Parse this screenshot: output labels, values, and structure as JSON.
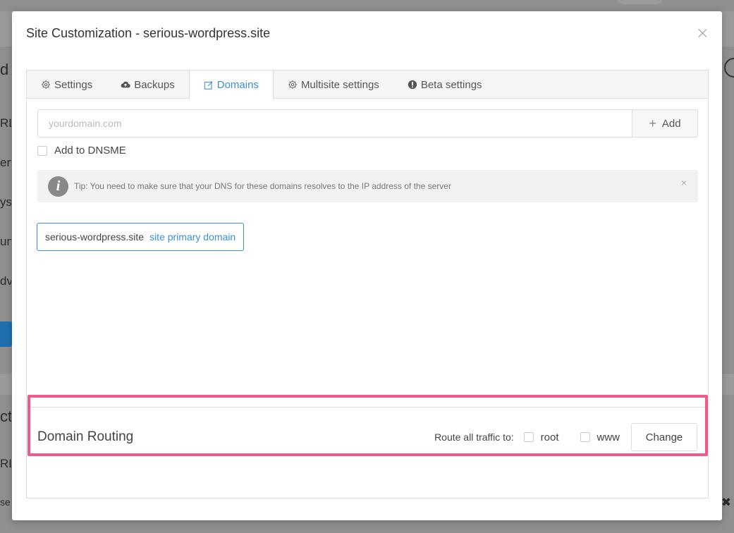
{
  "background": {
    "fragments": [
      "d",
      "RL",
      "erv",
      "yst",
      "un",
      "dv",
      "ct",
      "RL",
      "se"
    ],
    "right_close": "✖"
  },
  "modal": {
    "title": "Site Customization - serious-wordpress.site",
    "close_label": "×"
  },
  "tabs": [
    {
      "label": "Settings",
      "icon": "gear-icon",
      "active": false
    },
    {
      "label": "Backups",
      "icon": "cloud-upload-icon",
      "active": false
    },
    {
      "label": "Domains",
      "icon": "edit-icon",
      "active": true
    },
    {
      "label": "Multisite settings",
      "icon": "gear-icon",
      "active": false
    },
    {
      "label": "Beta settings",
      "icon": "exclamation-circle-icon",
      "active": false
    }
  ],
  "domains": {
    "input_placeholder": "yourdomain.com",
    "input_value": "",
    "add_button": "Add",
    "dnsme_label": "Add to DNSME",
    "tip": "Tip: You need to make sure that your DNS for these domains resolves to the IP address of the server",
    "tip_close": "×",
    "list": [
      {
        "domain": "serious-wordpress.site",
        "tag": "site primary domain"
      }
    ]
  },
  "routing": {
    "title": "Domain Routing",
    "label": "Route all traffic to:",
    "options": [
      "root",
      "www"
    ],
    "change_button": "Change"
  },
  "colors": {
    "accent": "#3a8fd8",
    "highlight": "#ec5b8c",
    "overlay": "#8f8f8f"
  }
}
